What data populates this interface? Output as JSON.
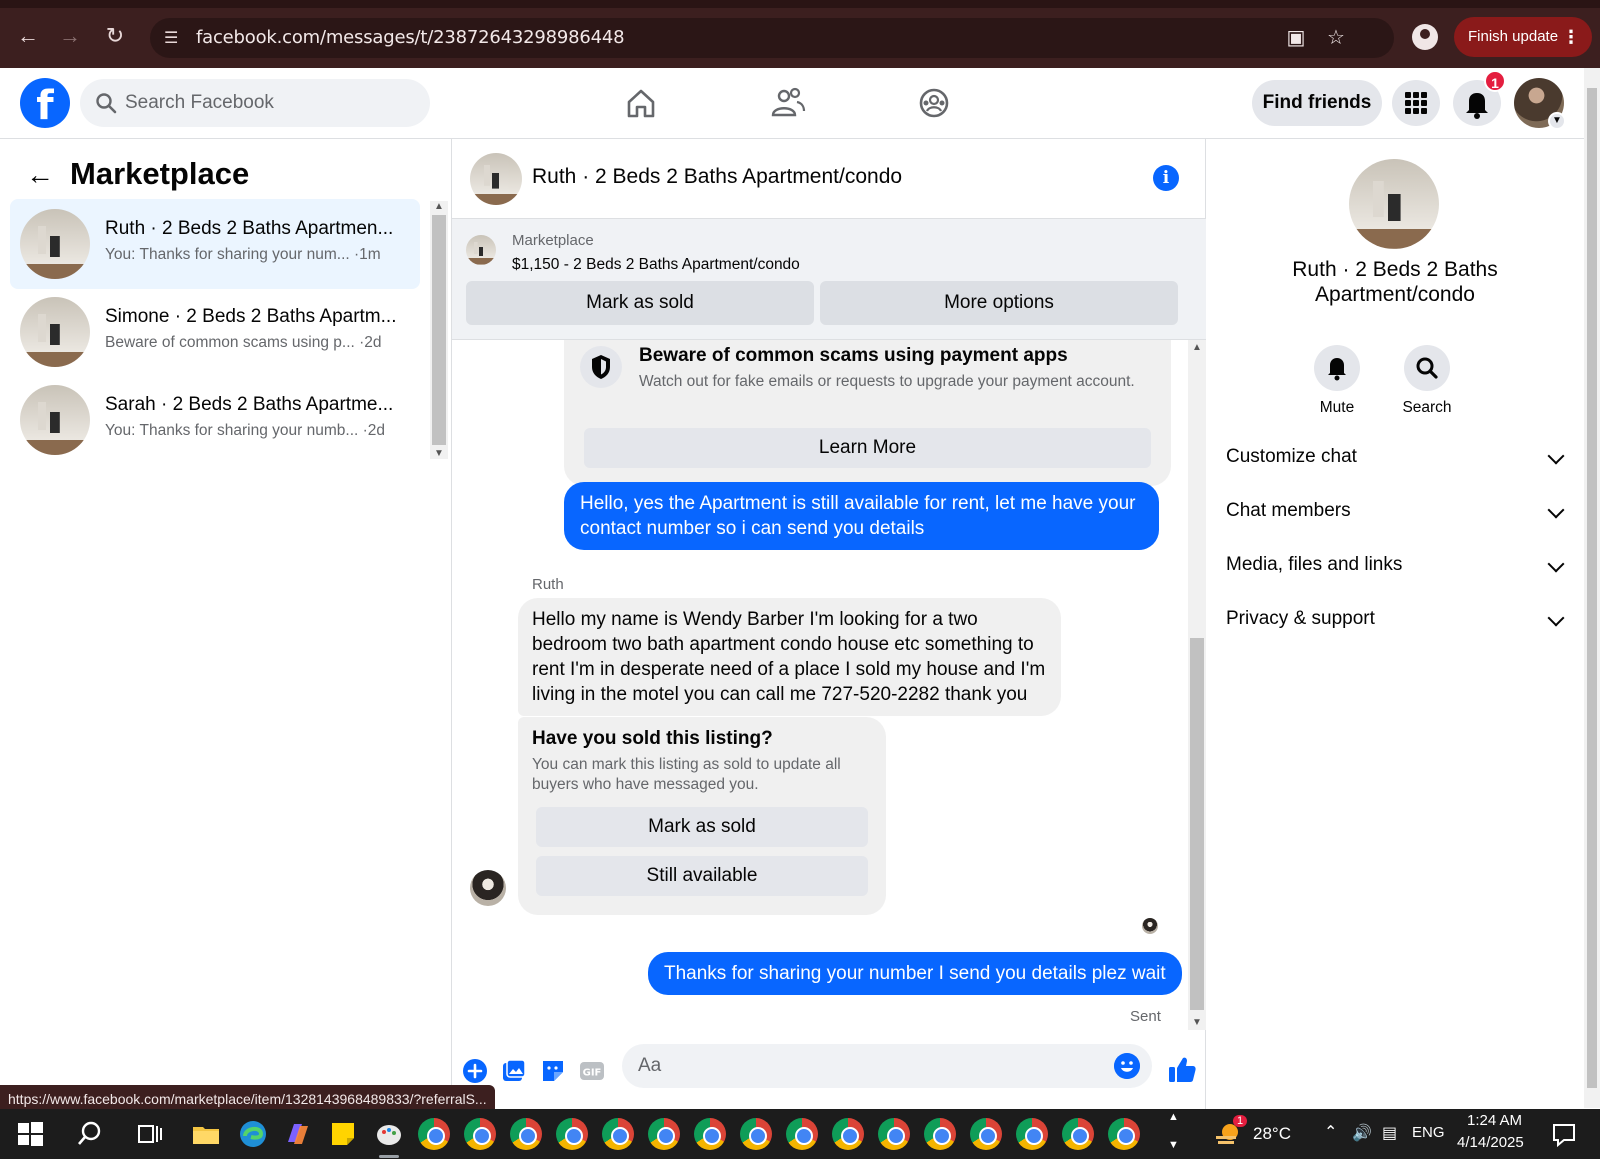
{
  "browser": {
    "url": "facebook.com/messages/t/23872643298986448",
    "update_label": "Finish update",
    "status_url": "https://www.facebook.com/marketplace/item/1328143968489833/?referralS..."
  },
  "topbar": {
    "logo": "f",
    "search_placeholder": "Search Facebook",
    "find_friends": "Find friends",
    "notif_count": "1"
  },
  "left": {
    "title": "Marketplace",
    "conversations": [
      {
        "name": "Ruth · 2 Beds 2 Baths Apartmen...",
        "snippet": "You: Thanks for sharing your num... ·1m"
      },
      {
        "name": "Simone · 2 Beds 2 Baths Apartm...",
        "snippet": "Beware of common scams using p... ·2d"
      },
      {
        "name": "Sarah · 2 Beds 2 Baths Apartme...",
        "snippet": "You: Thanks for sharing your numb... ·2d"
      }
    ]
  },
  "chat": {
    "header_name": "Ruth · 2 Beds 2 Baths Apartment/condo",
    "listing_label": "Marketplace",
    "listing_price": "$1,150 - 2 Beds 2 Baths Apartment/condo",
    "mark_as_sold": "Mark as sold",
    "more_options": "More options",
    "scam_title": "Beware of common scams using payment apps",
    "scam_body": "Watch out for fake emails or requests to upgrade your payment account.",
    "learn_more": "Learn More",
    "msg_out_1": "Hello, yes the Apartment is still available for rent, let me have your contact number so i can send you details",
    "sender": "Ruth",
    "msg_in_1": "Hello my name is Wendy Barber I'm looking for a two bedroom two bath apartment condo house etc something to rent I'm in desperate need of a place I sold my house and I'm living in the motel you can call me 727-520-2282 thank you",
    "sold_title": "Have you sold this listing?",
    "sold_body": "You can mark this listing as sold to update all buyers who have messaged you.",
    "sold_btn": "Mark as sold",
    "still_available": "Still available",
    "msg_out_2": "Thanks for sharing your number I send you details plez wait",
    "sent": "Sent",
    "composer_placeholder": "Aa"
  },
  "info": {
    "name": "Ruth · 2 Beds 2 Baths Apartment/condo",
    "mute": "Mute",
    "search": "Search",
    "sections": [
      "Customize chat",
      "Chat members",
      "Media, files and links",
      "Privacy & support"
    ]
  },
  "taskbar": {
    "weather_badge": "1",
    "temp": "28°C",
    "lang": "ENG",
    "time": "1:24 AM",
    "date": "4/14/2025"
  },
  "colors": {
    "fb_blue": "#0866ff",
    "chrome_bg": "#3c1f1f",
    "bubble_in": "#f0f0f0"
  }
}
